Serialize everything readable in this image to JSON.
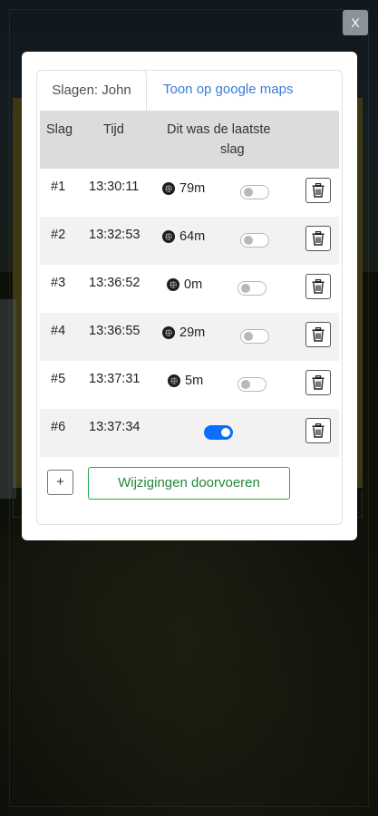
{
  "close_label": "X",
  "tabs": {
    "active_label": "Slagen: John",
    "link_label": "Toon op google maps"
  },
  "table": {
    "headers": {
      "slag": "Slag",
      "tijd": "Tijd",
      "last_line1": "Dit was de laatste",
      "last_line2": "slag"
    },
    "rows": [
      {
        "slag": "#1",
        "tijd": "13:30:11",
        "distance": "79m",
        "last_shot": false
      },
      {
        "slag": "#2",
        "tijd": "13:32:53",
        "distance": "64m",
        "last_shot": false
      },
      {
        "slag": "#3",
        "tijd": "13:36:52",
        "distance": "0m",
        "last_shot": false
      },
      {
        "slag": "#4",
        "tijd": "13:36:55",
        "distance": "29m",
        "last_shot": false
      },
      {
        "slag": "#5",
        "tijd": "13:37:31",
        "distance": "5m",
        "last_shot": false
      },
      {
        "slag": "#6",
        "tijd": "13:37:34",
        "distance": "",
        "last_shot": true
      }
    ]
  },
  "actions": {
    "add_label": "+",
    "apply_label": "Wijzigingen doorvoeren"
  },
  "colors": {
    "accent_blue": "#0d6efd",
    "link_blue": "#3b7bd8",
    "success_green": "#28a745",
    "header_gray": "#dcdcdc"
  }
}
